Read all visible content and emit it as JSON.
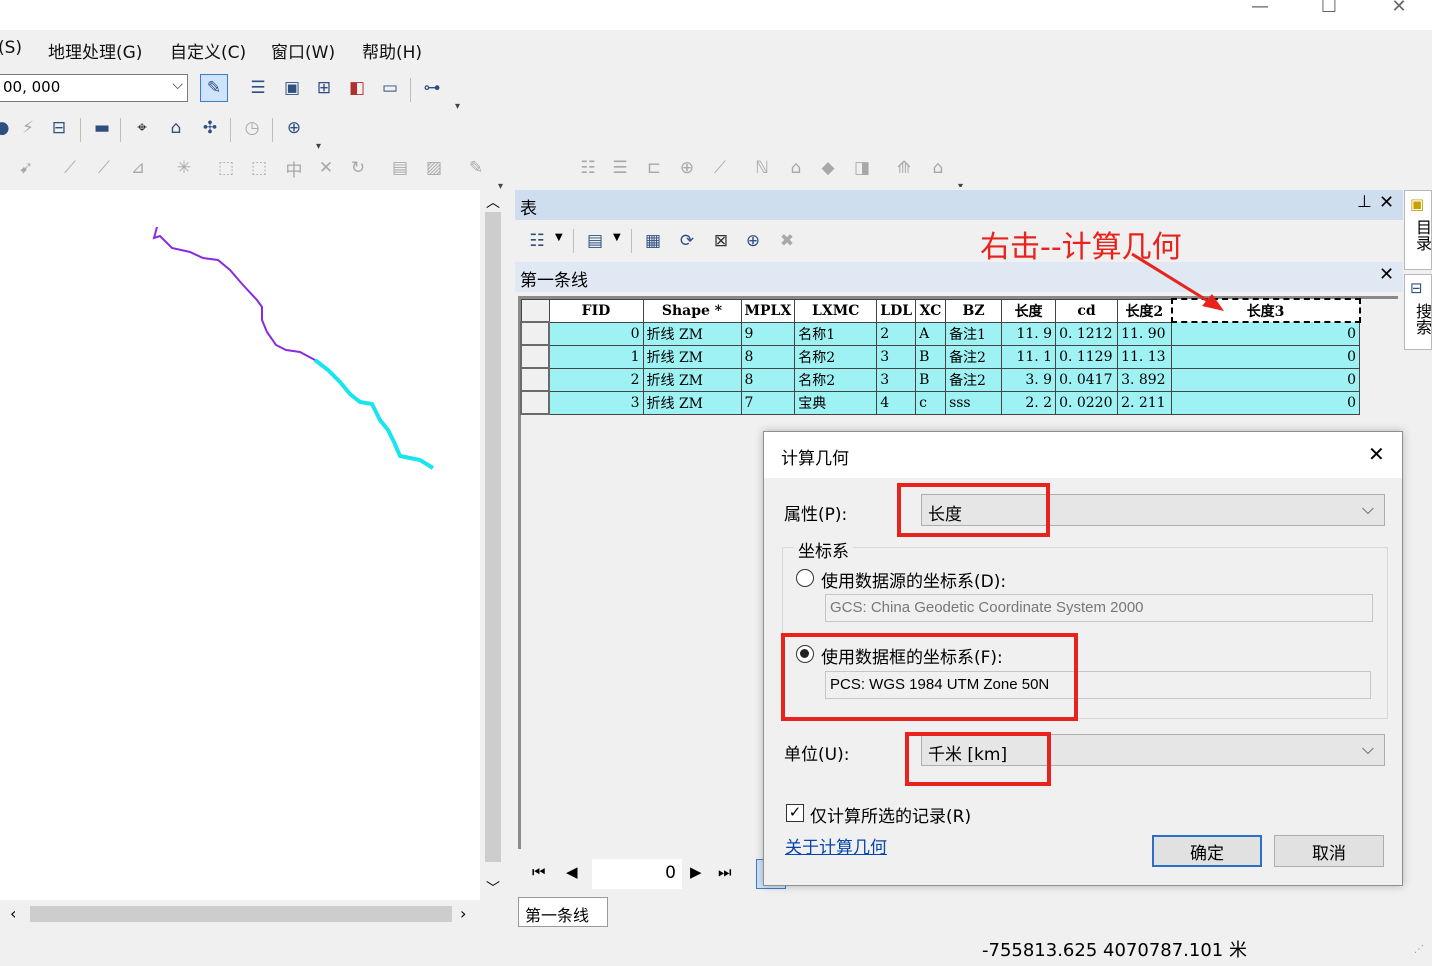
{
  "menu": {
    "items": [
      "(S)",
      "地理处理(G)",
      "自定义(C)",
      "窗口(W)",
      "帮助(H)"
    ]
  },
  "toolbar": {
    "scale_value": "00, 000"
  },
  "table_window": {
    "title": "表",
    "layer_name": "第一条线",
    "columns": [
      "FID",
      "Shape *",
      "MPLX",
      "LXMC",
      "LDL",
      "XC",
      "BZ",
      "长度",
      "cd",
      "长度2",
      "长度3"
    ],
    "rows": [
      [
        "0",
        "折线 ZM",
        "9",
        "名称1",
        "2",
        "A",
        "备注1",
        "11. 9",
        "0. 1212",
        "11. 90",
        "0"
      ],
      [
        "1",
        "折线 ZM",
        "8",
        "名称2",
        "3",
        "B",
        "备注2",
        "11. 1",
        "0. 1129",
        "11. 13",
        "0"
      ],
      [
        "2",
        "折线 ZM",
        "8",
        "名称2",
        "3",
        "B",
        "备注2",
        "3. 9",
        "0. 0417",
        "3. 892",
        "0"
      ],
      [
        "3",
        "折线 ZM",
        "7",
        "宝典",
        "4",
        "c",
        "sss",
        "2. 2",
        "0. 0220",
        "2. 211",
        "0"
      ]
    ],
    "nav_record": "0",
    "bottom_tab": "第一条线"
  },
  "annotation": {
    "text": "右击--计算几何",
    "color": "#e8231d"
  },
  "dialog": {
    "title": "计算几何",
    "property_label": "属性(P):",
    "property_value": "长度",
    "coord_group": "坐标系",
    "radio_source_label": "使用数据源的坐标系(D):",
    "radio_source_value": "GCS: China Geodetic Coordinate System 2000",
    "radio_frame_label": "使用数据框的坐标系(F):",
    "radio_frame_value": "PCS: WGS 1984 UTM Zone 50N",
    "unit_label": "单位(U):",
    "unit_value": "千米 [km]",
    "checkbox_label": "仅计算所选的记录(R)",
    "link_text": "关于计算几何",
    "ok": "确定",
    "cancel": "取消"
  },
  "status": {
    "coords": "-755813.625  4070787.101 米"
  },
  "right_dock": {
    "catalog": "目录",
    "search": "搜索"
  },
  "colors": {
    "selection": "#9ef2f4",
    "line_purple": "#8a2be2",
    "line_cyan": "#19e5ee",
    "highlight": "#e8231d"
  }
}
